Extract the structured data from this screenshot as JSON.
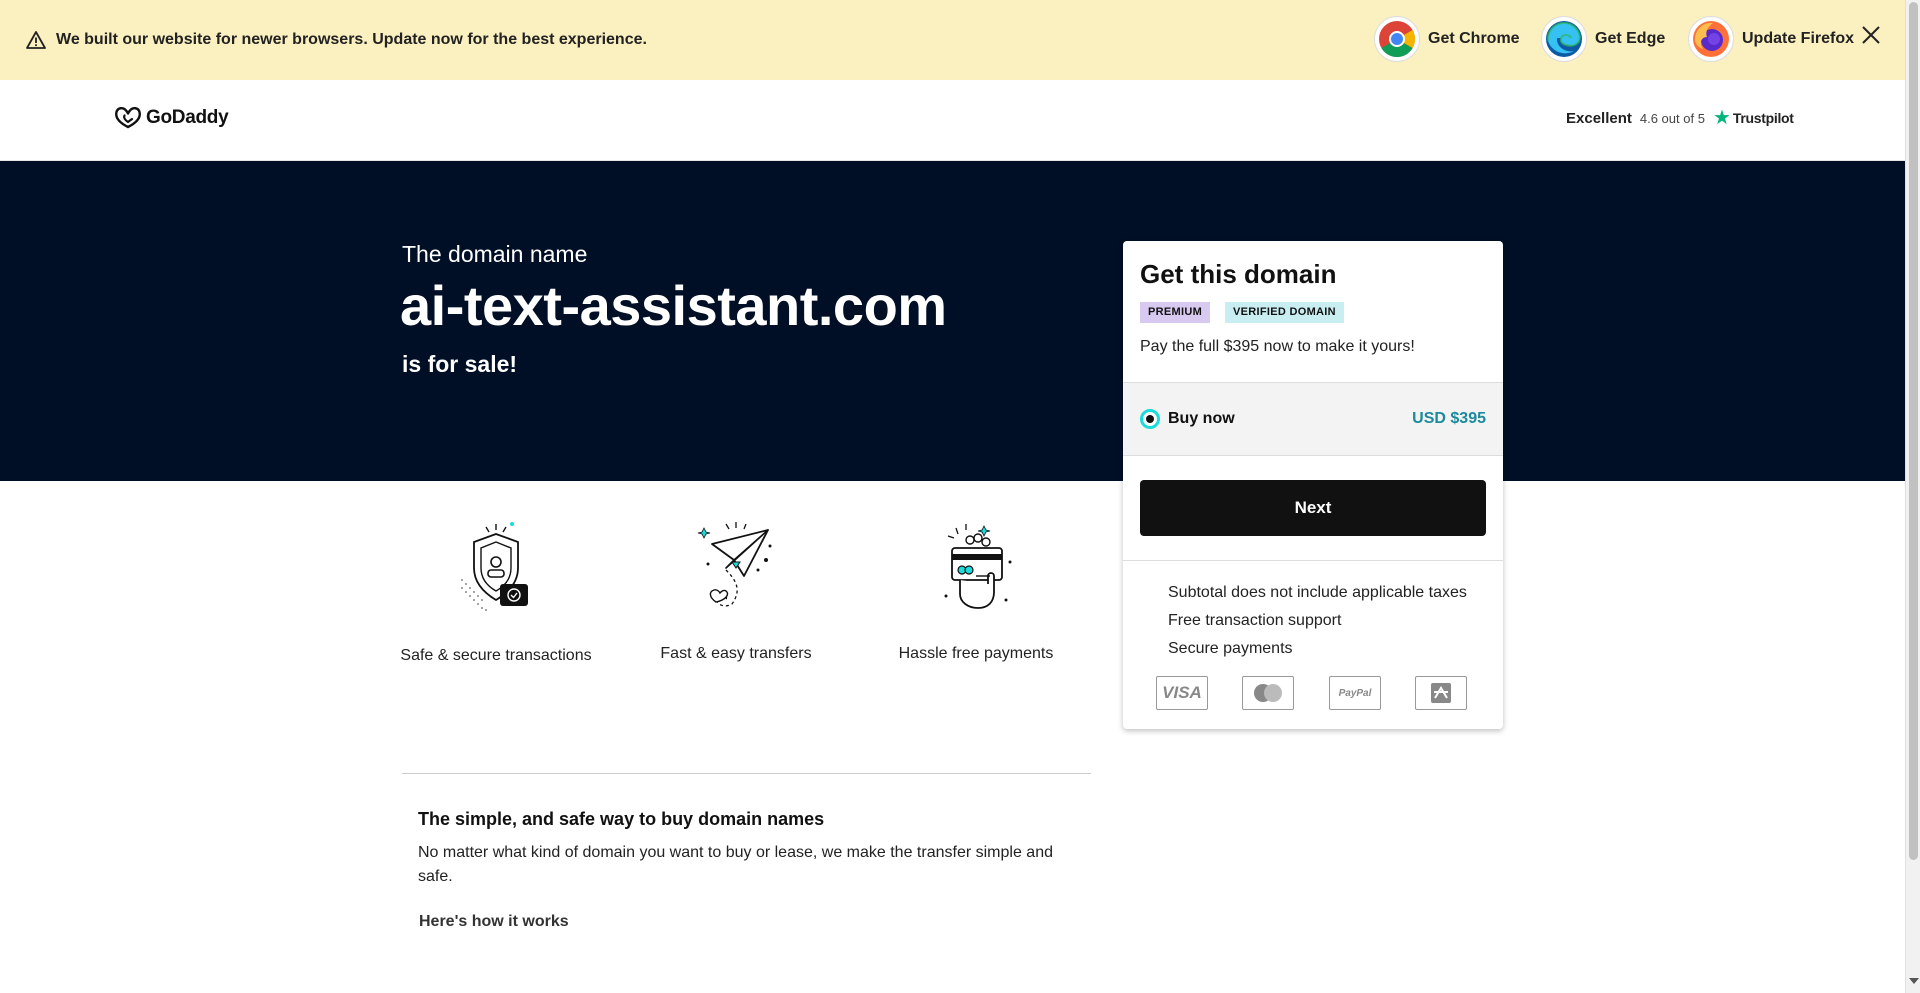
{
  "banner": {
    "message": "We built our website for newer browsers. Update now for the best experience.",
    "chrome_label": "Get Chrome",
    "edge_label": "Get Edge",
    "firefox_label": "Update Firefox"
  },
  "header": {
    "brand": "GoDaddy",
    "trust_rating": "Excellent",
    "trust_score": "4.6 out of 5",
    "trust_name": "Trustpilot"
  },
  "hero": {
    "pre": "The domain name",
    "domain": "ai-text-assistant.com",
    "post": "is for sale!"
  },
  "card": {
    "title": "Get this domain",
    "badge_premium": "PREMIUM",
    "badge_verified": "VERIFIED DOMAIN",
    "description": "Pay the full $395 now to make it yours!",
    "option_label": "Buy now",
    "option_price": "USD $395",
    "next_label": "Next",
    "bullets": [
      "Subtotal does not include applicable taxes",
      "Free transaction support",
      "Secure payments"
    ],
    "payment_icons": [
      "visa-icon",
      "mastercard-icon",
      "paypal-icon",
      "bank-transfer-icon"
    ],
    "visa_text": "VISA",
    "paypal_text": "PayPal"
  },
  "features": [
    {
      "label": "Safe & secure transactions",
      "icon": "shield-icon"
    },
    {
      "label": "Fast & easy transfers",
      "icon": "paper-plane-icon"
    },
    {
      "label": "Hassle free payments",
      "icon": "payment-hand-icon"
    }
  ],
  "section": {
    "title": "The simple, and safe way to buy domain names",
    "body": "No matter what kind of domain you want to buy or lease, we make the transfer simple and safe.",
    "link": "Here's how it works"
  },
  "colors": {
    "banner_bg": "#fbf0c0",
    "hero_bg": "#000f26",
    "accent_teal": "#1bdbdb",
    "price_teal": "#1b8a9c",
    "trustpilot_green": "#00b67a"
  }
}
